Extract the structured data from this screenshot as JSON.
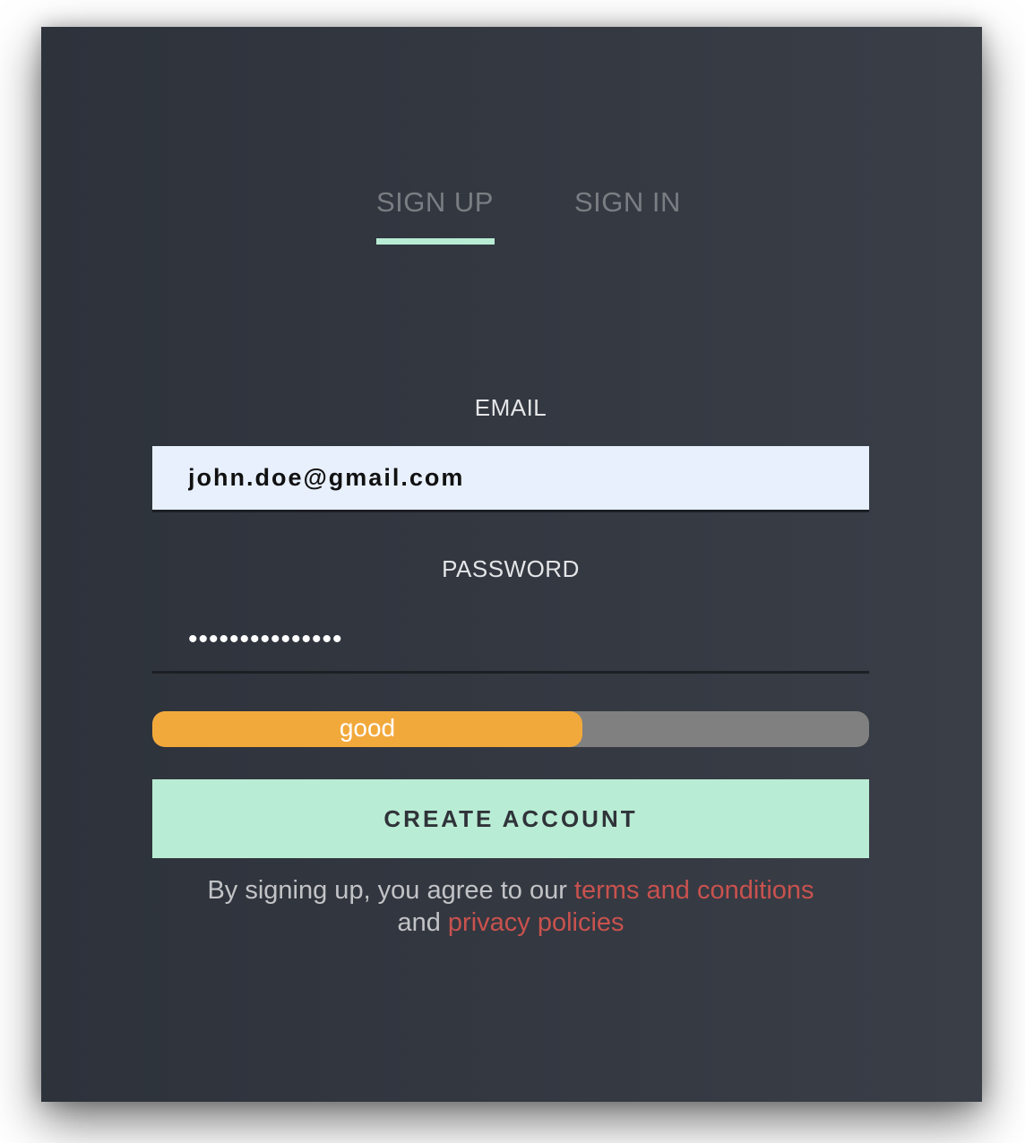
{
  "tabs": {
    "signup_label": "SIGN UP",
    "signin_label": "SIGN IN",
    "active": "signup"
  },
  "form": {
    "email_label": "EMAIL",
    "email_value": "john.doe@gmail.com",
    "password_label": "PASSWORD",
    "password_value": "•••••••••••••••"
  },
  "strength": {
    "label": "good",
    "fraction": 0.6,
    "fill_color": "#f2a93b",
    "track_color": "#808080"
  },
  "button": {
    "label": "CREATE ACCOUNT"
  },
  "terms": {
    "prefix": "By signing up, you agree to our",
    "terms_link": "terms and conditions",
    "middle": "and",
    "privacy_link": "privacy policies"
  },
  "colors": {
    "accent": "#b9ecd4",
    "link": "#c9524e",
    "background": "#2d323b"
  }
}
